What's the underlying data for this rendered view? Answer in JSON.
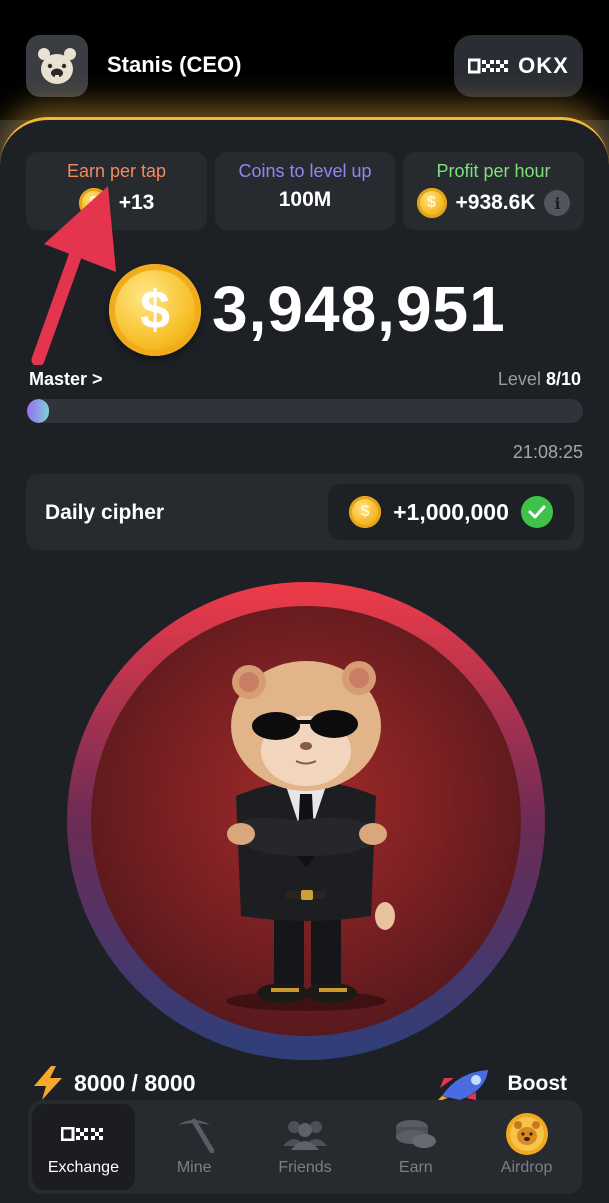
{
  "header": {
    "username": "Stanis (CEO)",
    "exchange_button": "OKX"
  },
  "stats": [
    {
      "title": "Earn per tap",
      "value": "+13",
      "title_color": "#f28b5d"
    },
    {
      "title": "Coins to level up",
      "value": "100M",
      "title_color": "#8d88f5"
    },
    {
      "title": "Profit per hour",
      "value": "+938.6K",
      "title_color": "#7ee07d"
    }
  ],
  "balance": "3,948,951",
  "league": {
    "name": "Master",
    "chevron": ">"
  },
  "level": {
    "label": "Level",
    "value": "8/10"
  },
  "progress": {
    "fraction": 0.04
  },
  "timer": "21:08:25",
  "daily_cipher": {
    "title": "Daily cipher",
    "reward": "+1,000,000"
  },
  "energy": {
    "value": "8000 / 8000"
  },
  "boost": {
    "label": "Boost"
  },
  "nav": [
    {
      "label": "Exchange",
      "icon": "okx-icon",
      "active": true
    },
    {
      "label": "Mine",
      "icon": "pickaxe-icon",
      "active": false
    },
    {
      "label": "Friends",
      "icon": "friends-icon",
      "active": false
    },
    {
      "label": "Earn",
      "icon": "coins-stack-icon",
      "active": false
    },
    {
      "label": "Airdrop",
      "icon": "hamster-coin-icon",
      "active": false
    }
  ],
  "colors": {
    "accent": "#f3b63a",
    "background": "#1d2025",
    "card": "#272a2f",
    "energy": "#f7a72a"
  }
}
